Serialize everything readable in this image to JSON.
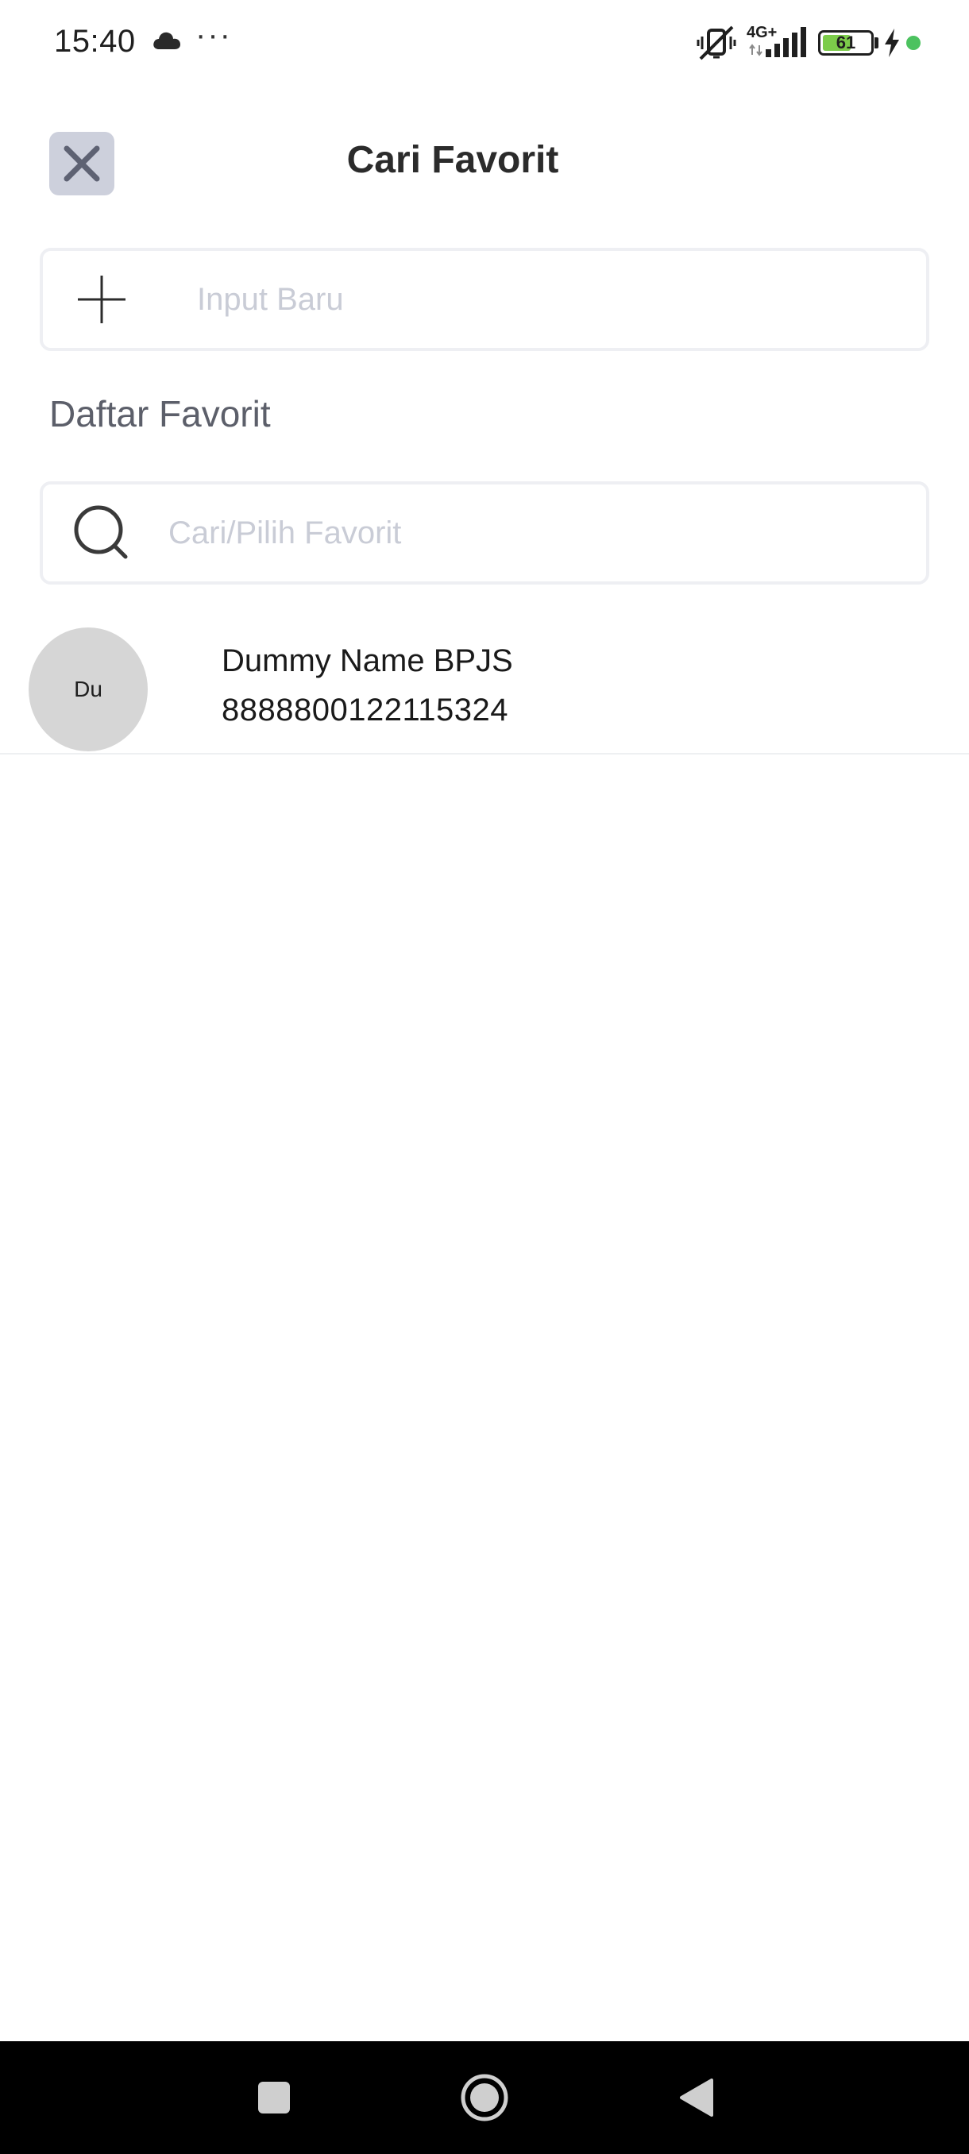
{
  "status_bar": {
    "time": "15:40",
    "overflow_dots": "···",
    "network_label": "4G+",
    "battery_level": "61",
    "battery_fraction": 0.61
  },
  "header": {
    "title": "Cari Favorit",
    "close_icon": "close-icon"
  },
  "new_input": {
    "placeholder": "Input Baru",
    "icon": "plus-icon"
  },
  "favorites": {
    "section_label": "Daftar Favorit",
    "search_placeholder": "Cari/Pilih Favorit",
    "search_icon": "search-icon",
    "items": [
      {
        "avatar_initials": "Du",
        "name": "Dummy Name BPJS",
        "number": "8888800122115324"
      }
    ]
  },
  "nav_bar": {
    "recents_icon": "square-icon",
    "home_icon": "circle-icon",
    "back_icon": "triangle-back-icon"
  },
  "colors": {
    "close_button_bg": "#cdd0dc",
    "input_border": "#eeeff3",
    "placeholder": "#c9ccd6",
    "avatar_bg": "#d6d6d6",
    "battery_fill": "#7ccc4a",
    "status_dot": "#4cc25f"
  }
}
